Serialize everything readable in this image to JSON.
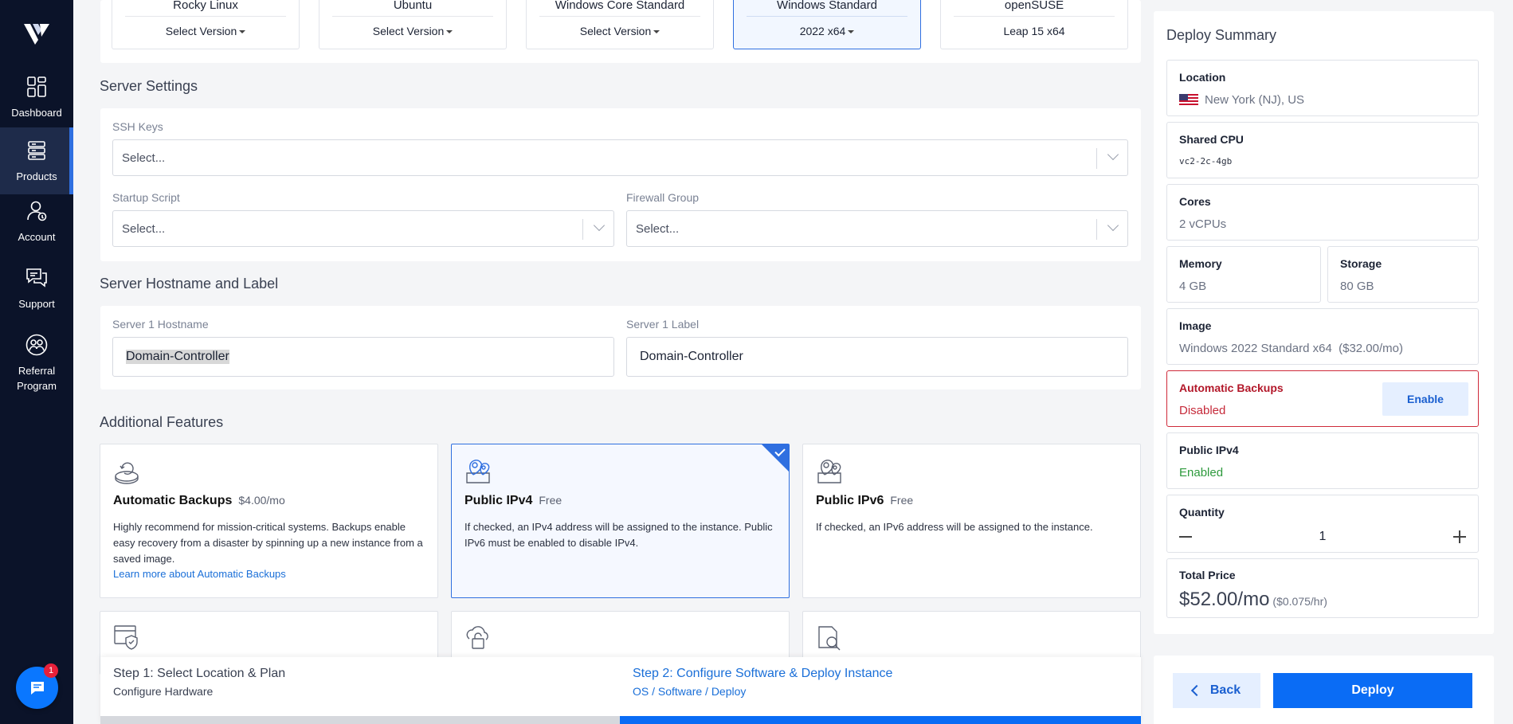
{
  "nav": {
    "items": [
      {
        "label": "Dashboard",
        "icon": "grid-icon"
      },
      {
        "label": "Products",
        "icon": "servers-icon"
      },
      {
        "label": "Account",
        "icon": "user-icon"
      },
      {
        "label": "Support",
        "icon": "chat-bubbles-icon"
      },
      {
        "label": "Referral\nProgram",
        "icon": "referral-icon"
      }
    ],
    "chat_badge": "1"
  },
  "os_cards": [
    {
      "name": "Rocky Linux",
      "version": "Select Version"
    },
    {
      "name": "Ubuntu",
      "version": "Select Version"
    },
    {
      "name": "Windows Core Standard",
      "version": "Select Version"
    },
    {
      "name": "Windows Standard",
      "version": "2022 x64"
    },
    {
      "name": "openSUSE",
      "version": "Leap 15 x64"
    }
  ],
  "server_settings": {
    "title": "Server Settings",
    "ssh_keys_label": "SSH Keys",
    "ssh_keys_value": "Select...",
    "startup_script_label": "Startup Script",
    "startup_script_value": "Select...",
    "firewall_group_label": "Firewall Group",
    "firewall_group_value": "Select..."
  },
  "hostname": {
    "title": "Server Hostname and Label",
    "hostname_label": "Server 1 Hostname",
    "hostname_value": "Domain-Controller",
    "label_label": "Server 1 Label",
    "label_value": "Domain-Controller"
  },
  "features": {
    "title": "Additional Features",
    "backups": {
      "title": "Automatic Backups",
      "price": "$4.00/mo",
      "desc": "Highly recommend for mission-critical systems. Backups enable easy recovery from a disaster by spinning up a new instance from a saved image.",
      "link": "Learn more about Automatic Backups"
    },
    "ipv4": {
      "title": "Public IPv4",
      "price": "Free",
      "desc": "If checked, an IPv4 address will be assigned to the instance. Public IPv6 must be enabled to disable IPv4."
    },
    "ipv6": {
      "title": "Public IPv6",
      "price": "Free",
      "desc": "If checked, an IPv6 address will be assigned to the instance."
    }
  },
  "steps": {
    "step1_title": "Step 1: Select Location & Plan",
    "step1_sub": "Configure Hardware",
    "step2_title": "Step 2: Configure Software & Deploy Instance",
    "step2_sub": "OS / Software / Deploy"
  },
  "summary": {
    "title": "Deploy Summary",
    "location_label": "Location",
    "location_value": "New York (NJ), US",
    "cpu_label": "Shared CPU",
    "cpu_value": "vc2-2c-4gb",
    "cores_label": "Cores",
    "cores_value": "2 vCPUs",
    "memory_label": "Memory",
    "memory_value": "4 GB",
    "storage_label": "Storage",
    "storage_value": "80 GB",
    "image_label": "Image",
    "image_value": "Windows 2022 Standard x64  ($32.00/mo)",
    "backups_label": "Automatic Backups",
    "backups_value": "Disabled",
    "enable_label": "Enable",
    "ipv4_label": "Public IPv4",
    "ipv4_value": "Enabled",
    "quantity_label": "Quantity",
    "quantity_value": "1",
    "total_label": "Total Price",
    "total_value": "$52.00/mo",
    "total_hourly": "($0.075/hr)"
  },
  "actions": {
    "back_label": "Back",
    "deploy_label": "Deploy"
  },
  "colors": {
    "accent": "#0a6cf5",
    "sidebar": "#0b1329",
    "warning": "#cf2a3a",
    "success": "#2e9a3d"
  }
}
